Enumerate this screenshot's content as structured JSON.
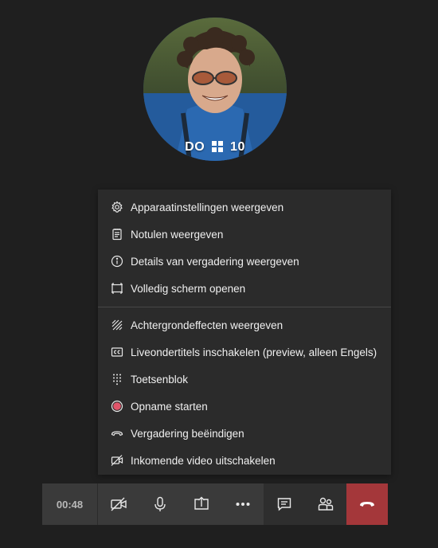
{
  "participant": {
    "initials": "DO",
    "suffix": "10"
  },
  "menu": {
    "items": [
      {
        "label": "Apparaatinstellingen weergeven",
        "icon": "gear-icon"
      },
      {
        "label": "Notulen weergeven",
        "icon": "notes-icon"
      },
      {
        "label": "Details van vergadering weergeven",
        "icon": "info-icon"
      },
      {
        "label": "Volledig scherm openen",
        "icon": "fullscreen-icon"
      },
      {
        "label": "Achtergrondeffecten weergeven",
        "icon": "background-effects-icon"
      },
      {
        "label": "Liveondertitels inschakelen (preview, alleen Engels)",
        "icon": "cc-icon"
      },
      {
        "label": "Toetsenblok",
        "icon": "keypad-icon"
      },
      {
        "label": "Opname starten",
        "icon": "record-icon"
      },
      {
        "label": "Vergadering beëindigen",
        "icon": "end-meeting-icon"
      },
      {
        "label": "Inkomende video uitschakelen",
        "icon": "video-off-icon"
      }
    ]
  },
  "controls": {
    "timer": "00:48",
    "buttons": [
      "camera-off-icon",
      "microphone-icon",
      "share-screen-icon",
      "more-icon",
      "chat-icon",
      "participants-icon",
      "hang-up-icon"
    ]
  },
  "colors": {
    "hangup": "#a4373a",
    "record": "#e0556a"
  }
}
